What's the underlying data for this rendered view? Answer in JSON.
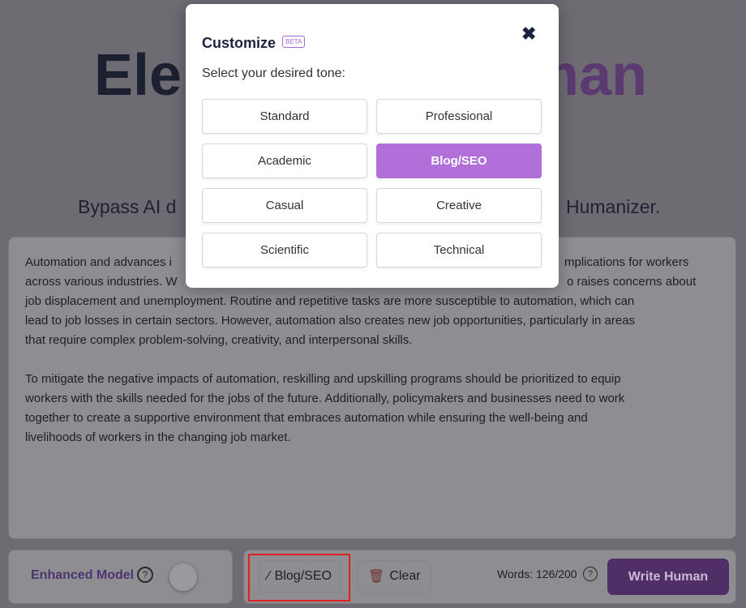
{
  "page": {
    "title_left": "Ele",
    "title_right": "man",
    "subtitle_left": "Bypass AI d",
    "subtitle_right": "Humanizer."
  },
  "editor": {
    "lines_partial": [
      [
        "Automation and advances i",
        "mplications for workers"
      ],
      [
        "across various industries. W",
        "o raises concerns about"
      ]
    ],
    "lines": [
      "job displacement and unemployment. Routine and repetitive tasks are more susceptible to automation, which can",
      "lead to job losses in certain sectors. However, automation also creates new job opportunities, particularly in areas",
      "that require complex problem-solving, creativity, and interpersonal skills."
    ],
    "paragraph2": [
      "To mitigate the negative impacts of automation, reskilling and upskilling programs should be prioritized to equip",
      "workers with the skills needed for the jobs of the future. Additionally, policymakers and businesses need to work",
      "together to create a supportive environment that embraces automation while ensuring the well-being and",
      "livelihoods of workers in the changing job market."
    ]
  },
  "footer": {
    "enhanced_model": "Enhanced Model",
    "enhanced_on": false,
    "tone_button": "Blog/SEO",
    "clear_button": "Clear",
    "words": "Words: 126/200",
    "write_button": "Write Human"
  },
  "modal": {
    "title": "Customize",
    "badge": "BETA",
    "prompt": "Select your desired tone:",
    "selected": "Blog/SEO",
    "tones": [
      "Standard",
      "Professional",
      "Academic",
      "Blog/SEO",
      "Casual",
      "Creative",
      "Scientific",
      "Technical"
    ]
  },
  "colors": {
    "accent": "#b06fd9",
    "write_button": "#8a4bb5",
    "highlight": "#e02020"
  }
}
